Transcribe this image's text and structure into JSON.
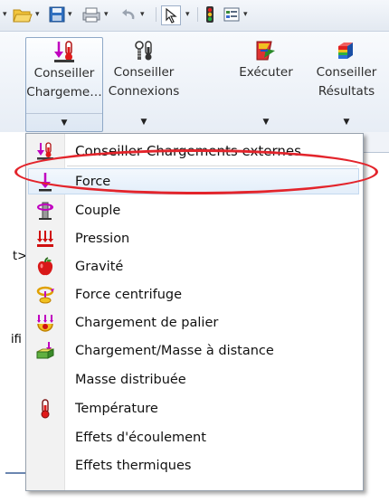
{
  "ribbon": {
    "buttons": [
      {
        "label_line1": "Conseiller",
        "label_line2": "Chargeme…",
        "icon": "loads-advisor-icon"
      },
      {
        "label_line1": "Conseiller",
        "label_line2": "Connexions",
        "icon": "connections-advisor-icon"
      },
      {
        "label_line1": "Exécuter",
        "label_line2": "",
        "icon": "run-icon"
      },
      {
        "label_line1": "Conseiller",
        "label_line2": "Résultats",
        "icon": "results-advisor-icon"
      }
    ]
  },
  "left_fragments": [
    "t>",
    "ifi"
  ],
  "menu": {
    "items": [
      {
        "label": "Conseiller Chargements externes",
        "icon": "loads-advisor-icon"
      },
      {
        "label": "Force",
        "icon": "force-arrow-icon"
      },
      {
        "label": "Couple",
        "icon": "torque-icon"
      },
      {
        "label": "Pression",
        "icon": "pressure-icon"
      },
      {
        "label": "Gravité",
        "icon": "gravity-apple-icon"
      },
      {
        "label": "Force centrifuge",
        "icon": "centrifugal-icon"
      },
      {
        "label": "Chargement de palier",
        "icon": "bearing-load-icon"
      },
      {
        "label": "Chargement/Masse à distance",
        "icon": "remote-load-icon"
      },
      {
        "label": "Masse distribuée",
        "icon": ""
      },
      {
        "label": "Température",
        "icon": "thermometer-icon"
      },
      {
        "label": "Effets d'écoulement",
        "icon": ""
      },
      {
        "label": "Effets thermiques",
        "icon": ""
      }
    ]
  },
  "colors": {
    "annotation": "#e3242b",
    "force": "#c000c0"
  }
}
